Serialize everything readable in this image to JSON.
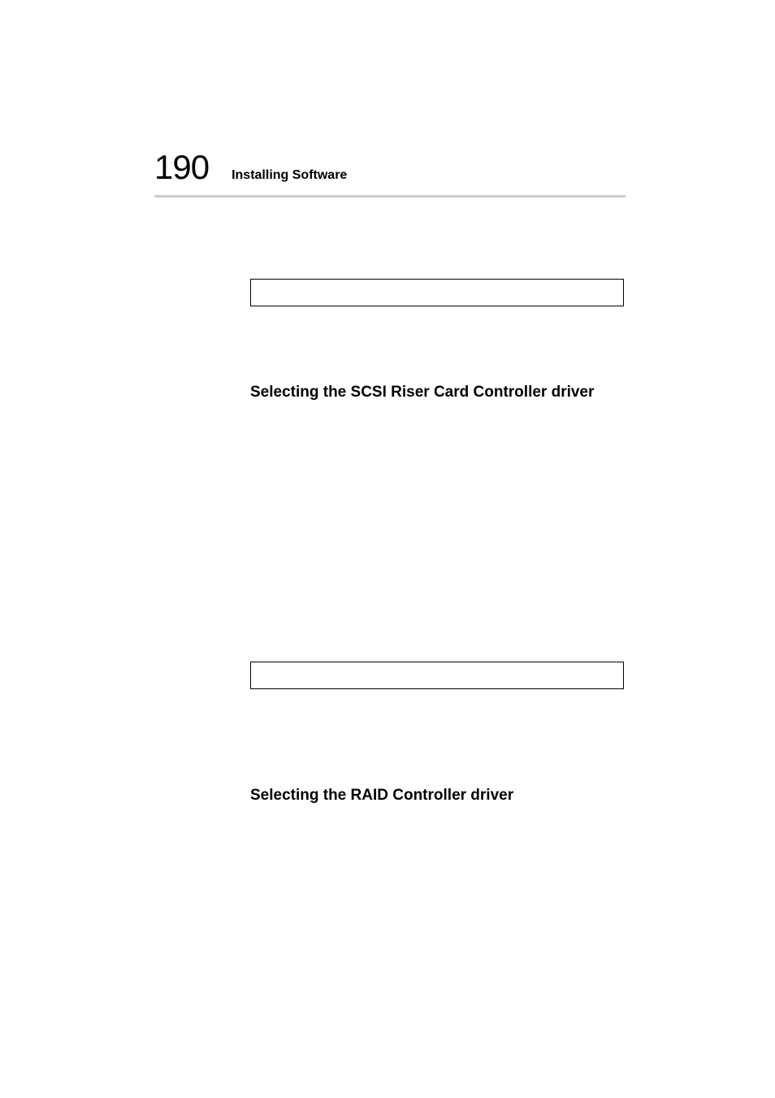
{
  "header": {
    "page_number": "190",
    "chapter_title": "Installing Software"
  },
  "sections": {
    "heading_1": "Selecting the SCSI Riser Card Controller driver",
    "heading_2": "Selecting the RAID Controller driver"
  }
}
